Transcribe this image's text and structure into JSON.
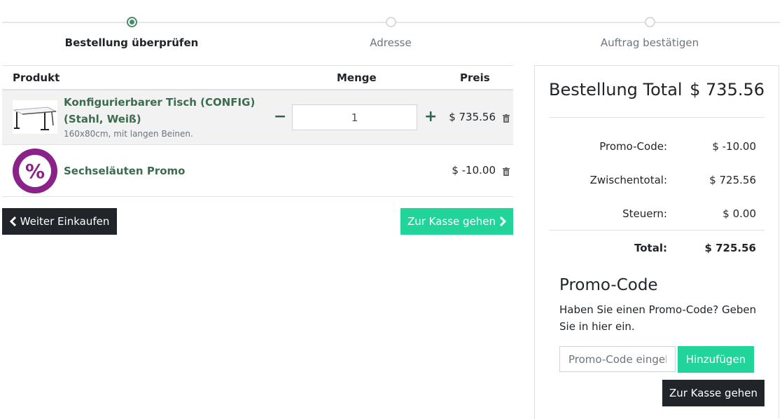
{
  "steps": [
    {
      "label": "Bestellung überprüfen",
      "active": true
    },
    {
      "label": "Adresse",
      "active": false
    },
    {
      "label": "Auftrag bestätigen",
      "active": false
    }
  ],
  "cart": {
    "columns": {
      "product": "Produkt",
      "quantity": "Menge",
      "price": "Preis"
    },
    "items": [
      {
        "name_line1": "Konfigurierbarer Tisch (CONFIG)",
        "name_line2": "(Stahl, Weiß)",
        "description": "160x80cm, mit langen Beinen.",
        "quantity": "1",
        "price": "$ 735.56"
      },
      {
        "name": "Sechseläuten Promo",
        "badge": "%",
        "price": "$ -10.00"
      }
    ]
  },
  "buttons": {
    "continue_shopping": "Weiter Einkaufen",
    "checkout": "Zur Kasse gehen",
    "apply_promo": "Hinzufügen",
    "checkout_summary": "Zur Kasse gehen"
  },
  "summary": {
    "title": "Bestellung Total",
    "total_amount": "$ 735.56",
    "rows": [
      {
        "label": "Promo-Code:",
        "value": "$ -10.00"
      },
      {
        "label": "Zwischentotal:",
        "value": "$ 725.56"
      },
      {
        "label": "Steuern:",
        "value": "$ 0.00"
      },
      {
        "label": "Total:",
        "value": "$ 725.56"
      }
    ],
    "promo": {
      "heading": "Promo-Code",
      "text": "Haben Sie einen Promo-Code? Geben Sie in hier ein.",
      "placeholder": "Promo-Code eingeben"
    }
  },
  "colors": {
    "accent_green": "#21d49a",
    "product_link": "#3c6c4f",
    "promo_purple": "#8b2289",
    "dark_button": "#212529"
  },
  "icons": {
    "trash": "trash-icon",
    "chevron_left": "chevron-left-icon",
    "chevron_right": "chevron-right-icon",
    "minus": "minus-icon",
    "plus": "plus-icon"
  }
}
